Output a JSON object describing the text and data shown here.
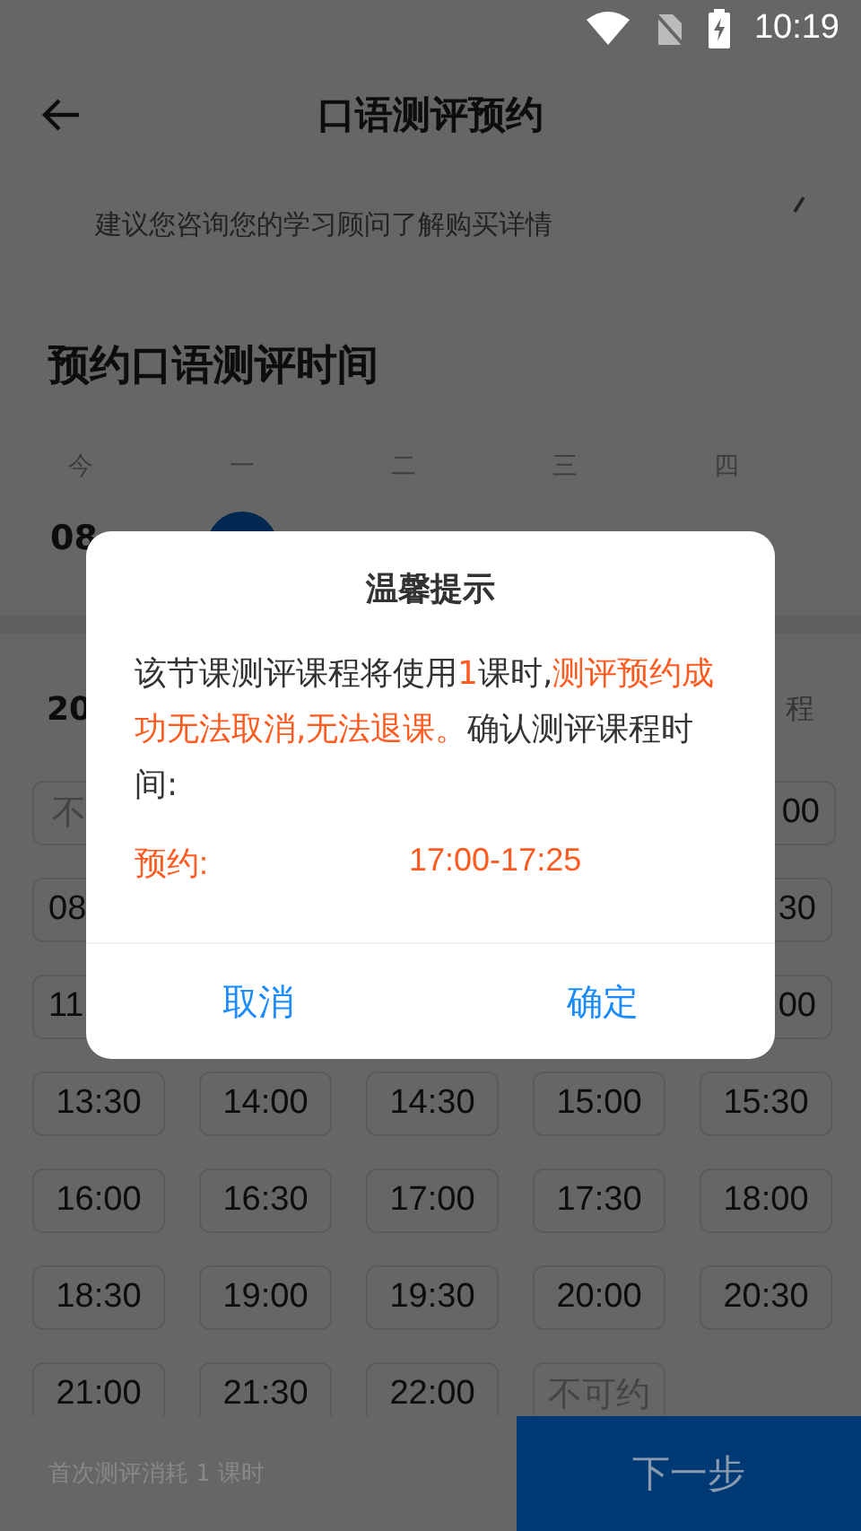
{
  "status_bar": {
    "time": "10:19"
  },
  "header": {
    "title": "口语测评预约"
  },
  "notice": {
    "text": "建议您咨询您的学习顾问了解购买详情"
  },
  "section_title": "预约口语测评时间",
  "days": [
    {
      "weekday": "今",
      "date": "08",
      "selected": false
    },
    {
      "weekday": "一",
      "selected": true
    },
    {
      "weekday": "二",
      "selected": false
    },
    {
      "weekday": "三",
      "selected": false
    },
    {
      "weekday": "四",
      "selected": false
    }
  ],
  "date_row": {
    "date": "20",
    "note": "程"
  },
  "partial_rows": [
    {
      "first": {
        "text": "不",
        "available": false
      },
      "last": {
        "text": "00",
        "available": true
      }
    },
    {
      "first": {
        "text": "08",
        "available": true
      },
      "last": {
        "text": "30",
        "available": true
      }
    },
    {
      "first": {
        "text": "11",
        "available": true
      },
      "last": {
        "text": "00",
        "available": true
      }
    }
  ],
  "slot_rows": [
    [
      {
        "text": "13:30",
        "available": true
      },
      {
        "text": "14:00",
        "available": true
      },
      {
        "text": "14:30",
        "available": true
      },
      {
        "text": "15:00",
        "available": true
      },
      {
        "text": "15:30",
        "available": true
      }
    ],
    [
      {
        "text": "16:00",
        "available": true
      },
      {
        "text": "16:30",
        "available": true
      },
      {
        "text": "17:00",
        "available": true
      },
      {
        "text": "17:30",
        "available": true
      },
      {
        "text": "18:00",
        "available": true
      }
    ],
    [
      {
        "text": "18:30",
        "available": true
      },
      {
        "text": "19:00",
        "available": true
      },
      {
        "text": "19:30",
        "available": true
      },
      {
        "text": "20:00",
        "available": true
      },
      {
        "text": "20:30",
        "available": true
      }
    ],
    [
      {
        "text": "21:00",
        "available": true
      },
      {
        "text": "21:30",
        "available": true
      },
      {
        "text": "22:00",
        "available": true
      },
      {
        "text": "不可约",
        "available": false
      }
    ]
  ],
  "footer": {
    "note": "首次测评消耗 1 课时",
    "next_button": "下一步"
  },
  "dialog": {
    "title": "温馨提示",
    "message": [
      {
        "text": "该节课测评课程将使用",
        "kind": "normal"
      },
      {
        "text": "1",
        "kind": "highlight"
      },
      {
        "text": "课时,",
        "kind": "normal"
      },
      {
        "text": "测评预约成功无法取消,无法退课。",
        "kind": "highlight"
      },
      {
        "text": "确认测评课程时间:",
        "kind": "normal"
      }
    ],
    "booking_label": "预约:",
    "booking_time": "17:00-17:25",
    "buttons": [
      "取消",
      "确定"
    ]
  }
}
